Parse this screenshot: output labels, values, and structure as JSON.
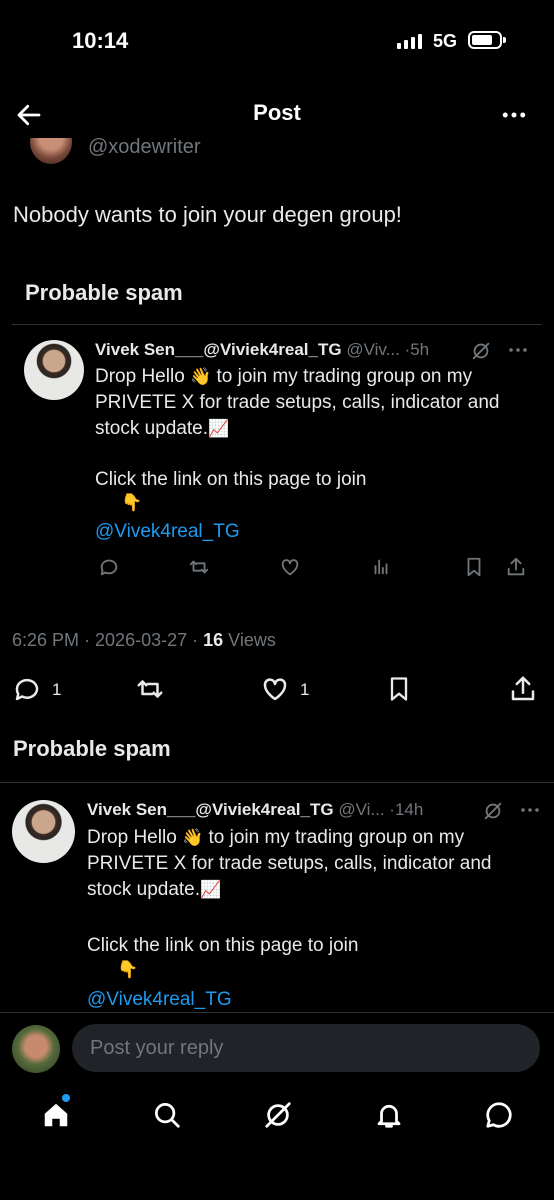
{
  "status_bar": {
    "time": "10:14",
    "network": "5G"
  },
  "nav": {
    "title": "Post"
  },
  "original_post": {
    "handle_cut": "@xodewriter",
    "text": "Nobody wants to join your degen group!",
    "timestamp": "6:26 PM · 2026-03-27 · ",
    "views_count": "16",
    "views_label": " Views",
    "reply_count": "1",
    "like_count": "1"
  },
  "replies": [
    {
      "spam_label": "Probable spam",
      "name": "Vivek Sen___@Viviek4real_TG",
      "handle": "@Viv...",
      "time": "·5h",
      "line1": "Drop Hello ",
      "emoji1": "👋",
      "line1_rest": " to join my trading group on my PRIVETE X for trade setups, calls, indicator and stock update.",
      "emoji2": "📈",
      "line2": "Click the link on this page to join",
      "emoji3": "👇",
      "link": "@Vivek4real_TG"
    },
    {
      "spam_label": "Probable spam",
      "name": "Vivek Sen___@Viviek4real_TG",
      "handle": "@Vi...",
      "time": "·14h",
      "line1": "Drop Hello ",
      "emoji1": "👋",
      "line1_rest": " to join my trading group on my PRIVETE X for trade setups, calls, indicator and stock update.",
      "emoji2": "📈",
      "line2": "Click the link on this page to join",
      "emoji3": "👇",
      "link": "@Vivek4real_TG"
    }
  ],
  "composer": {
    "placeholder": "Post your reply"
  },
  "icons": {
    "back": "arrow-left-icon",
    "more": "more-horizontal-icon",
    "reply": "reply-icon",
    "repost": "repost-icon",
    "like": "heart-icon",
    "views": "views-icon",
    "bookmark": "bookmark-icon",
    "share": "share-icon",
    "home": "home-icon",
    "search": "search-icon",
    "grok": "grok-icon",
    "notifications": "bell-icon",
    "messages": "message-icon"
  },
  "colors": {
    "background": "#000000",
    "accent": "#1d9bf0",
    "muted": "#71767b"
  }
}
